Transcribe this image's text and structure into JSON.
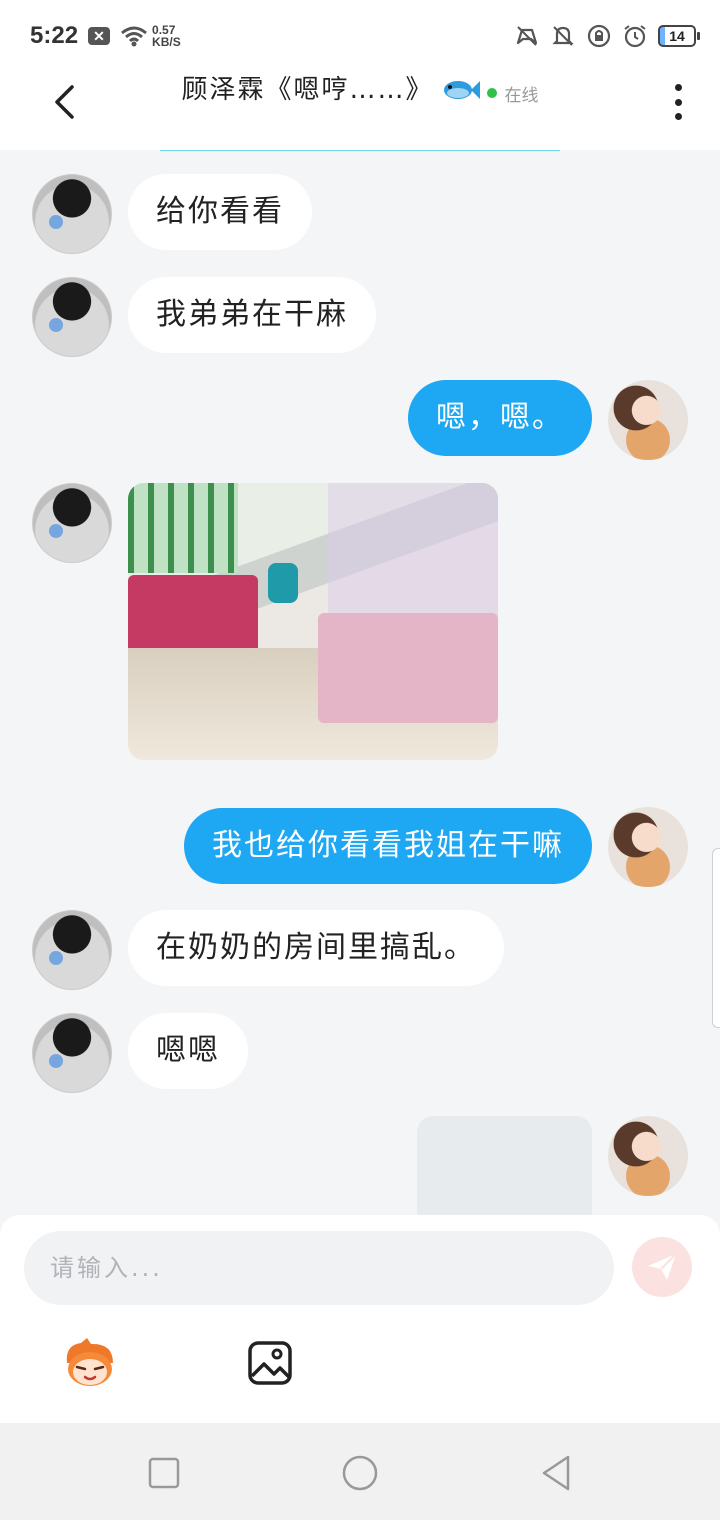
{
  "status_bar": {
    "time": "5:22",
    "notif_badge": "✕",
    "net_speed_value": "0.57",
    "net_speed_unit": "KB/S",
    "battery": "14"
  },
  "header": {
    "title": "顾泽霖《嗯哼……》",
    "status": "在线",
    "online_color": "#2ec24a"
  },
  "messages": [
    {
      "side": "left",
      "type": "text",
      "text": "给你看看"
    },
    {
      "side": "left",
      "type": "text",
      "text": "我弟弟在干麻"
    },
    {
      "side": "right",
      "type": "text",
      "text": "嗯，嗯。"
    },
    {
      "side": "left",
      "type": "image"
    },
    {
      "side": "right",
      "type": "text",
      "text": "我也给你看看我姐在干嘛"
    },
    {
      "side": "left",
      "type": "text",
      "text": "在奶奶的房间里搞乱。"
    },
    {
      "side": "left",
      "type": "text",
      "text": "嗯嗯"
    },
    {
      "side": "right",
      "type": "image"
    }
  ],
  "composer": {
    "placeholder": "请输入..."
  },
  "colors": {
    "outgoing_bubble": "#1ea7f2",
    "incoming_bubble": "#ffffff",
    "send_button": "#fbe2e0"
  },
  "icons": {
    "back": "chevron-left-icon",
    "more": "more-vertical-icon",
    "send": "send-icon",
    "emoji": "emoji-mascot-icon",
    "image": "image-icon"
  }
}
